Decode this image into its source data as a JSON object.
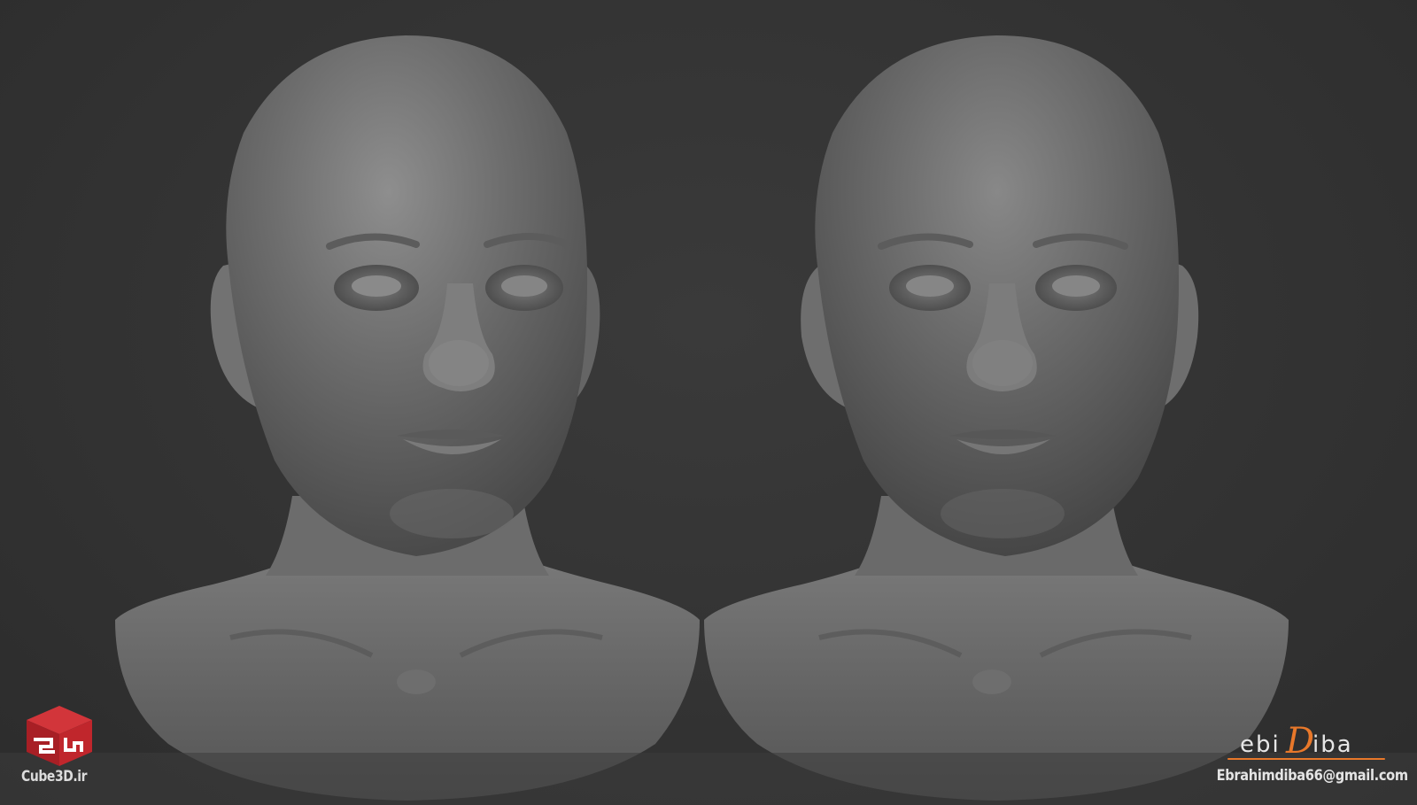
{
  "image": {
    "description_free": true,
    "background_color": "#323232",
    "accent_color": "#e8782a"
  },
  "branding": {
    "logo_icon": "cube-icon",
    "logo_color": "#c0262c",
    "site": "Cube3D.ir",
    "signature_prefix": "ebi",
    "signature_initial": "D",
    "signature_suffix": "iba",
    "email": "Ebrahimdiba66@gmail.com"
  }
}
